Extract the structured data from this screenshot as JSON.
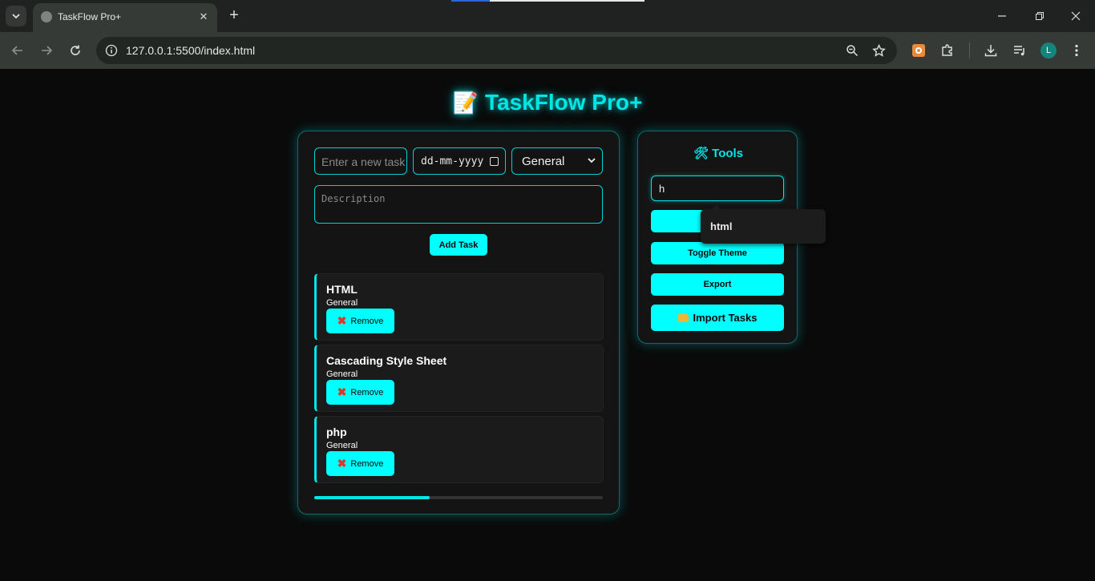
{
  "browser": {
    "tab_title": "TaskFlow Pro+",
    "url": "127.0.0.1:5500/index.html",
    "profile_initial": "L"
  },
  "app": {
    "emoji": "📝",
    "title": "TaskFlow Pro+"
  },
  "form": {
    "task_placeholder": "Enter a new task",
    "date_placeholder": "dd-mm-yyyy",
    "category_selected": "General",
    "description_placeholder": "Description",
    "add_button": "Add Task"
  },
  "tasks": [
    {
      "name": "HTML",
      "category": "General",
      "remove_label": "Remove"
    },
    {
      "name": "Cascading Style Sheet",
      "category": "General",
      "remove_label": "Remove"
    },
    {
      "name": "php",
      "category": "General",
      "remove_label": "Remove"
    }
  ],
  "progress": {
    "fraction": 0.4
  },
  "tools": {
    "title": "🛠 Tools",
    "search_value": "h",
    "toggle_theme": "Toggle Theme",
    "export": "Export",
    "import": "Import Tasks"
  },
  "autocomplete": {
    "suggestion": "html"
  },
  "colors": {
    "accent": "#00ffff",
    "background": "#0a0a0a",
    "panel": "#141414"
  }
}
